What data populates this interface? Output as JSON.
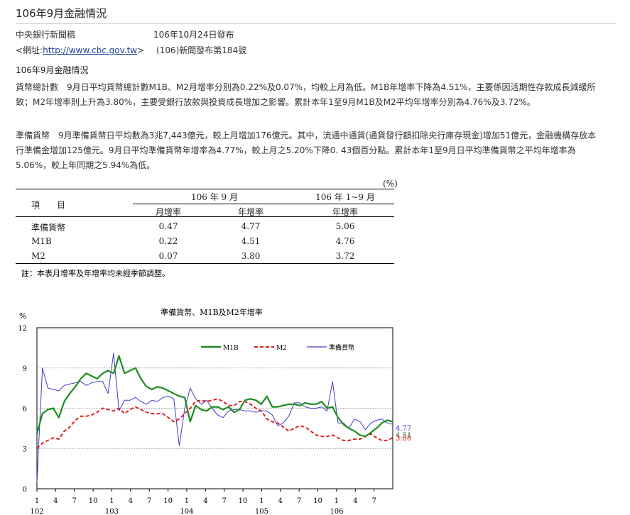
{
  "page": {
    "title": "106年9月金融情況",
    "publisher": "中央銀行新聞稿",
    "release_date": "106年10月24日發布",
    "url_prefix": "<網址:",
    "url": "http://www.cbc.gov.tw",
    "url_suffix": ">",
    "release_no": "(106)新聞發布第184號",
    "section_heading": "106年9月金融情況"
  },
  "paragraphs": [
    {
      "lead": "貨幣總計數",
      "text": "9月日平均貨幣總計數M1B、M2月增率分別為0.22%及0.07%，均較上月為低。M1B年增率下降為4.51%，主要係因活期性存款成長減緩所致；M2年增率則上升為3.80%，主要受銀行放款與投資成長增加之影響。累計本年1至9月M1B及M2平均年增率分別為4.76%及3.72%。"
    },
    {
      "lead": "準備貨幣",
      "text": "9月準備貨幣日平均數為3兆7,443億元，較上月增加176億元。其中，流通中通貨(通貨發行額扣除央行庫存現金)增加51億元，金融機構存放本行準備金增加125億元。9月日平均準備貨幣年增率為4.77%，較上月之5.20%下降0. 43個百分點。累計本年1至9月日平均準備貨幣之平均年增率為5.06%，較上年同期之5.94%為低。"
    }
  ],
  "table": {
    "unit": "(%)",
    "item_header": "項　　目",
    "group1": "106 年 9 月",
    "group2": "106 年 1~9 月",
    "col_mom": "月增率",
    "col_yoy": "年增率",
    "col_ytd": "年增率",
    "rows": [
      {
        "name": "準備貨幣",
        "mom": "0.47",
        "yoy": "4.77",
        "ytd": "5.06"
      },
      {
        "name": "M1B",
        "mom": "0.22",
        "yoy": "4.51",
        "ytd": "4.76"
      },
      {
        "name": "M2",
        "mom": "0.07",
        "yoy": "3.80",
        "ytd": "3.72"
      }
    ],
    "note": "註：本表月增率及年增率均未經季節調整。"
  },
  "colors": {
    "m1b": "#1e8c1e",
    "m2": "#e02020",
    "reserve": "#3c3cc8"
  },
  "chart_data": {
    "type": "line",
    "title": "準備貨幣、M1B及M2年增率",
    "ylabel": "%",
    "ylim": [
      0,
      12
    ],
    "yticks": [
      0,
      3,
      6,
      9,
      12
    ],
    "xlim": [
      0,
      57
    ],
    "x_tick_months": [
      "1",
      "4",
      "7",
      "10",
      "1",
      "4",
      "7",
      "10",
      "1",
      "4",
      "7",
      "10",
      "1",
      "4",
      "7",
      "10",
      "1",
      "4",
      "7"
    ],
    "x_tick_positions": [
      0,
      3,
      6,
      9,
      12,
      15,
      18,
      21,
      24,
      27,
      30,
      33,
      36,
      39,
      42,
      45,
      48,
      51,
      54
    ],
    "year_labels": [
      {
        "label": "102",
        "pos": 0
      },
      {
        "label": "103",
        "pos": 12
      },
      {
        "label": "104",
        "pos": 24
      },
      {
        "label": "105",
        "pos": 36
      },
      {
        "label": "106",
        "pos": 48
      }
    ],
    "grid": "horizontal dotted at 3, 6, 9",
    "legend": "top-right inside plot",
    "series": [
      {
        "name": "M1B",
        "style": "solid",
        "values": [
          4.1,
          5.6,
          5.9,
          6.0,
          5.3,
          6.5,
          7.1,
          7.6,
          8.2,
          8.6,
          8.4,
          8.2,
          8.6,
          8.8,
          8.6,
          9.9,
          8.6,
          8.8,
          9.0,
          8.2,
          7.6,
          7.4,
          7.6,
          7.5,
          7.3,
          7.1,
          6.9,
          6.8,
          5.0,
          6.2,
          5.9,
          5.8,
          6.1,
          6.1,
          5.9,
          6.1,
          5.7,
          5.9,
          6.6,
          6.7,
          6.6,
          6.3,
          6.9,
          6.1,
          6.1,
          6.2,
          6.3,
          6.3,
          6.2,
          6.4,
          6.3,
          6.3,
          6.5,
          6.0,
          6.1,
          5.3,
          4.8,
          4.5,
          4.3,
          4.0,
          3.9,
          4.2,
          4.5,
          4.9,
          5.1,
          5.0
        ]
      },
      {
        "name": "M2",
        "style": "dashed",
        "values": [
          3.0,
          3.4,
          3.6,
          3.8,
          3.7,
          4.3,
          4.6,
          5.1,
          5.4,
          5.4,
          5.5,
          5.7,
          6.0,
          5.9,
          5.8,
          6.0,
          5.6,
          5.9,
          6.1,
          5.9,
          5.7,
          5.6,
          5.6,
          5.6,
          5.3,
          5.0,
          5.2,
          5.6,
          6.0,
          6.5,
          6.6,
          6.5,
          6.6,
          6.7,
          6.5,
          6.2,
          6.2,
          6.5,
          6.5,
          6.3,
          6.0,
          5.8,
          5.2,
          5.0,
          4.9,
          4.6,
          4.3,
          4.5,
          4.7,
          4.6,
          4.3,
          4.0,
          3.9,
          3.9,
          4.0,
          3.8,
          3.6,
          3.6,
          3.7,
          3.7,
          3.9,
          4.1,
          3.8,
          3.6,
          3.6,
          3.8
        ]
      },
      {
        "name": "準備貨幣",
        "style": "solid-thin",
        "values": [
          0.5,
          9.0,
          7.5,
          7.4,
          7.3,
          7.7,
          7.8,
          7.9,
          8.0,
          7.7,
          7.9,
          8.0,
          8.0,
          7.1,
          10.1,
          5.8,
          6.6,
          6.6,
          6.8,
          6.5,
          6.3,
          6.6,
          6.5,
          6.8,
          6.9,
          6.7,
          3.2,
          6.0,
          7.5,
          6.7,
          6.3,
          6.6,
          6.0,
          5.5,
          5.3,
          5.8,
          5.9,
          5.9,
          5.8,
          5.8,
          5.7,
          5.8,
          5.8,
          5.5,
          4.7,
          4.9,
          5.4,
          6.4,
          6.4,
          6.1,
          6.0,
          6.0,
          6.1,
          5.8,
          8.0,
          4.9,
          4.9,
          4.5,
          5.2,
          5.0,
          4.4,
          4.9,
          5.1,
          5.2,
          4.9,
          4.8
        ]
      }
    ],
    "end_labels": [
      {
        "text": "4.77",
        "series": "準備貨幣"
      },
      {
        "text": "4.51",
        "series": "M1B"
      },
      {
        "text": "3.80",
        "series": "M2"
      }
    ]
  }
}
